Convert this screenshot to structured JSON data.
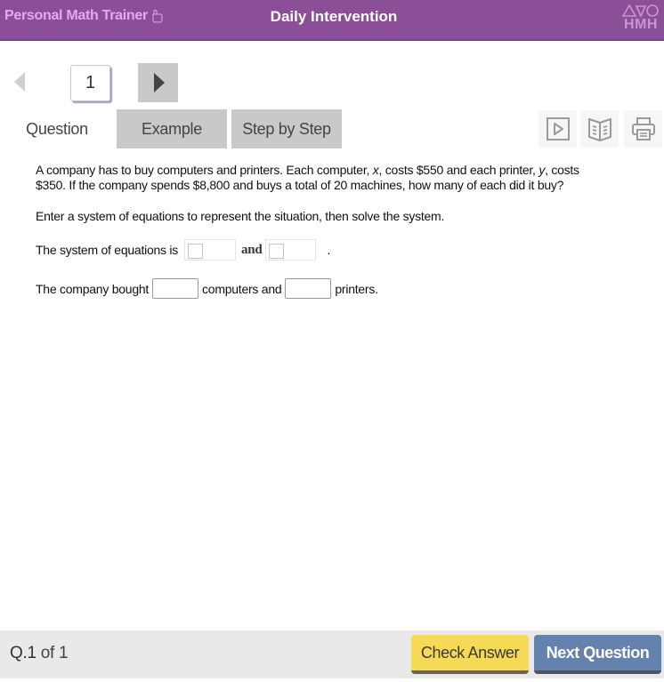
{
  "header": {
    "brand": "Personal Math Trainer",
    "title": "Daily Intervention",
    "logo_text": "HMH",
    "colors": {
      "bar": "#8a4f96",
      "brand_text": "#e8a6f4",
      "logo": "#c896d2"
    }
  },
  "pager": {
    "current_page": "1"
  },
  "tabs": [
    {
      "label": "Question",
      "active": true
    },
    {
      "label": "Example",
      "active": false
    },
    {
      "label": "Step by Step",
      "active": false
    }
  ],
  "tools": [
    {
      "name": "video",
      "icon": "play-video-icon"
    },
    {
      "name": "ebook",
      "icon": "open-book-icon"
    },
    {
      "name": "print",
      "icon": "printer-icon"
    }
  ],
  "question": {
    "problem_part1": "A company has to buy computers and printers. Each computer, ",
    "var_x": "x",
    "problem_part2": ", costs $550 and each printer, ",
    "var_y": "y",
    "problem_part3": ", costs $350. If the company spends $8,800 and buys a total of 20 machines, how many of each did it buy?",
    "instruction": "Enter a system of equations to represent the situation, then solve the system.",
    "system_label": "The system of equations is",
    "and_label": "and",
    "period": ".",
    "bought_label": "The company bought",
    "computers_label": "computers and",
    "printers_label": "printers.",
    "answers": {
      "equation1": "",
      "equation2": "",
      "computers": "",
      "printers": ""
    }
  },
  "footer": {
    "q_label": "Q.1",
    "of_label": "of 1",
    "check_answer": "Check Answer",
    "next_question": "Next Question",
    "colors": {
      "check": "#f6da55",
      "next": "#6581ad"
    }
  }
}
